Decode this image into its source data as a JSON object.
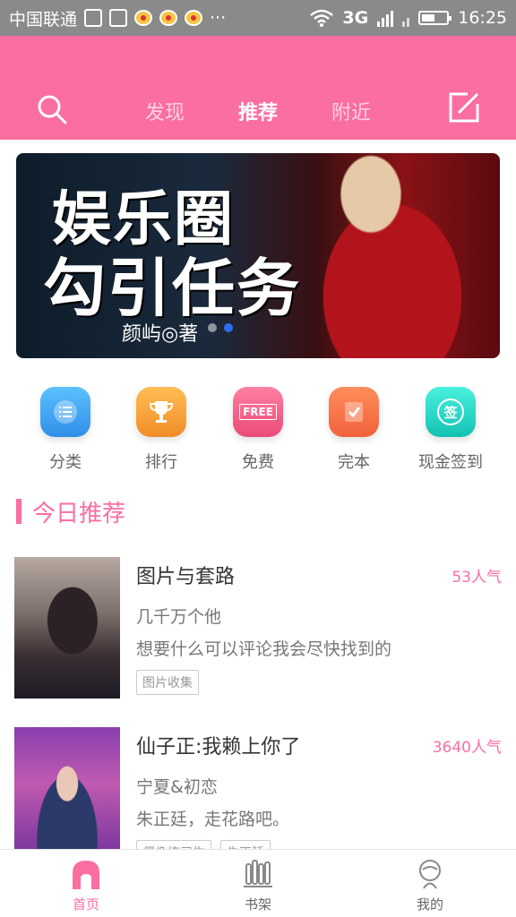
{
  "status_bar": {
    "carrier": "中国联通",
    "network": "3G",
    "time": "16:25",
    "more": "···"
  },
  "header": {
    "tabs": [
      {
        "label": "发现",
        "active": false
      },
      {
        "label": "推荐",
        "active": true
      },
      {
        "label": "附近",
        "active": false
      }
    ],
    "search_icon": "search-icon",
    "edit_icon": "edit-icon"
  },
  "banner": {
    "title_line1": "娱乐圈",
    "title_line2": "勾引任务",
    "author": "颜屿◎著",
    "page_count": 2,
    "active_index": 1
  },
  "categories": [
    {
      "label": "分类",
      "icon": "list-icon",
      "color": "#3aa6f5"
    },
    {
      "label": "排行",
      "icon": "trophy-icon",
      "color": "#f7a23a"
    },
    {
      "label": "免费",
      "icon": "free-icon",
      "icon_text": "FREE",
      "color": "#f25f86"
    },
    {
      "label": "完本",
      "icon": "checked-note-icon",
      "color": "#f7774a"
    },
    {
      "label": "现金签到",
      "icon": "sign-in-icon",
      "icon_text": "签",
      "color": "#23d2c4"
    }
  ],
  "section": {
    "title": "今日推荐"
  },
  "cards": [
    {
      "title": "图片与套路",
      "popularity": "53人气",
      "subtitle": "几千万个他",
      "description": "想要什么可以评论我会尽快找到的",
      "tags": [
        "图片收集"
      ]
    },
    {
      "title": "仙子正:我赖上你了",
      "popularity": "3640人气",
      "subtitle": "宁夏&初恋",
      "description": "朱正廷，走花路吧。",
      "tags": [
        "偶像练习生",
        "朱正廷"
      ]
    }
  ],
  "bottom_nav": [
    {
      "label": "首页",
      "icon": "home-icon",
      "active": true
    },
    {
      "label": "书架",
      "icon": "bookshelf-icon",
      "active": false
    },
    {
      "label": "我的",
      "icon": "profile-icon",
      "active": false
    }
  ],
  "colors": {
    "accent": "#fb6ea2",
    "status_bar": "#8a8a8a"
  }
}
